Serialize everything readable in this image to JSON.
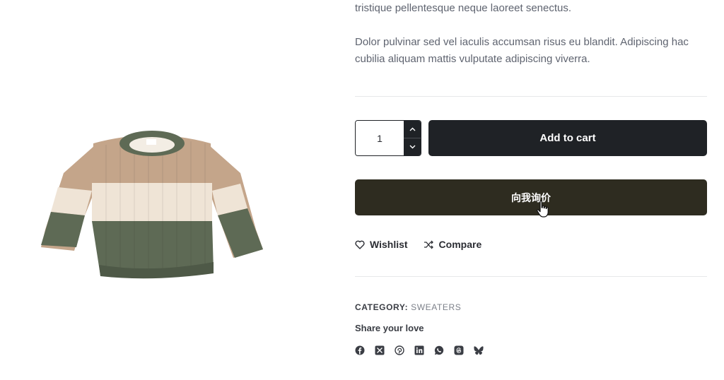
{
  "product": {
    "image_alt": "Striped knit sweater",
    "description": [
      "tristique pellentesque neque laoreet senectus.",
      "Dolor pulvinar sed vel iaculis accumsan risus eu blandit. Adipiscing hac cubilia aliquam mattis vulputate adipiscing viverra."
    ],
    "quantity": "1",
    "add_to_cart_label": "Add to cart",
    "inquiry_label": "向我询价",
    "wishlist_label": "Wishlist",
    "compare_label": "Compare",
    "category_key": "CATEGORY:",
    "category_value": "SWEATERS",
    "share_label": "Share your love"
  },
  "socials": [
    "facebook-icon",
    "x-icon",
    "pinterest-icon",
    "linkedin-icon",
    "whatsapp-icon",
    "threads-icon",
    "bluesky-icon"
  ],
  "colors": {
    "dark": "#1f2226",
    "inquiry": "#2e2c20",
    "sweater_green": "#5e6a55",
    "sweater_tan": "#c4a58a",
    "sweater_cream": "#efe4d6"
  }
}
